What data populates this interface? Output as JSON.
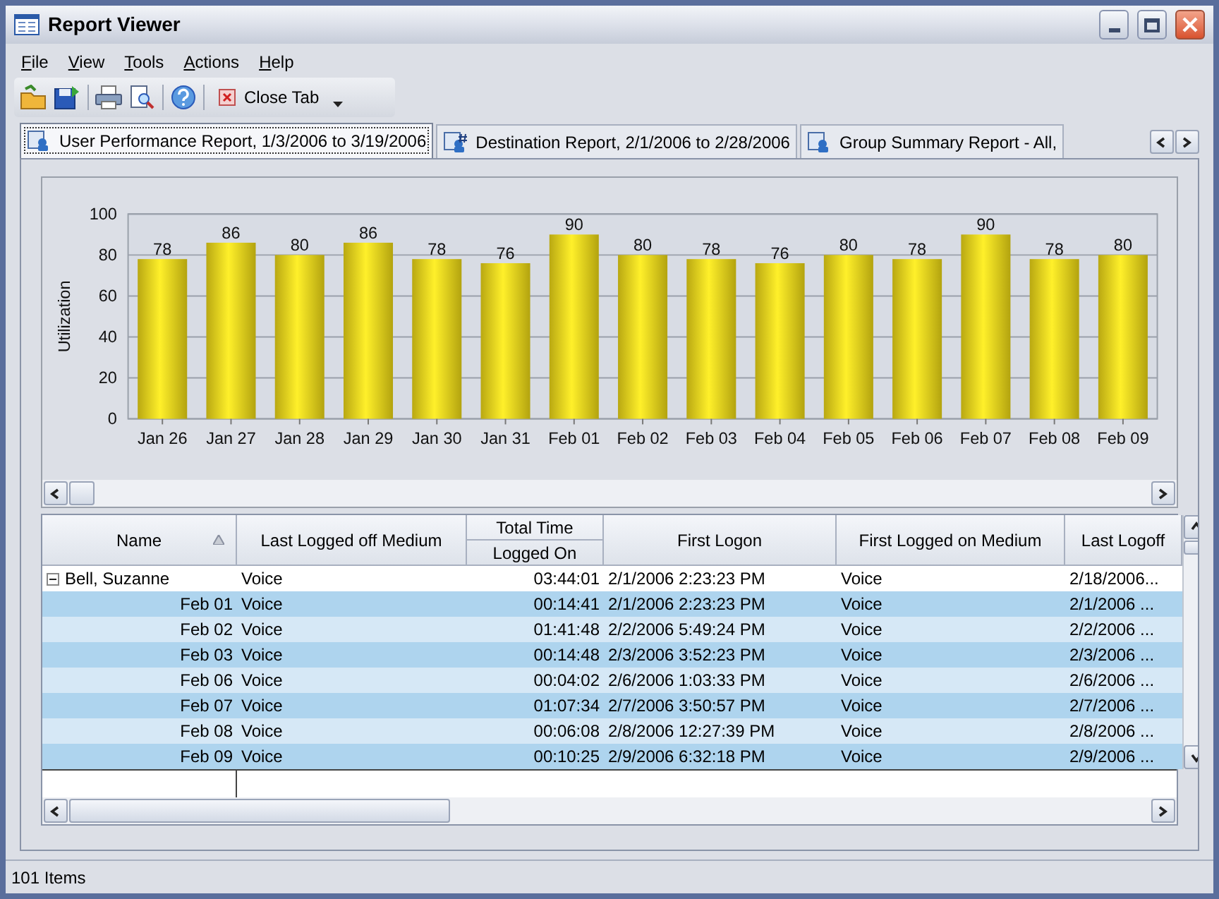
{
  "window": {
    "title": "Report Viewer"
  },
  "menu": [
    {
      "label": "File"
    },
    {
      "label": "View"
    },
    {
      "label": "Tools"
    },
    {
      "label": "Actions"
    },
    {
      "label": "Help"
    }
  ],
  "toolbar": {
    "close_tab": "Close Tab"
  },
  "tabs": [
    {
      "label": "User Performance Report, 1/3/2006 to 3/19/2006",
      "selected": true
    },
    {
      "label": "Destination Report, 2/1/2006 to 2/28/2006",
      "selected": false
    },
    {
      "label": "Group Summary Report - All,",
      "selected": false
    }
  ],
  "chart": {
    "chart_data": {
      "type": "bar",
      "ylabel": "Utilization",
      "categories": [
        "Jan 26",
        "Jan 27",
        "Jan 28",
        "Jan 29",
        "Jan 30",
        "Jan 31",
        "Feb 01",
        "Feb 02",
        "Feb 03",
        "Feb 04",
        "Feb 05",
        "Feb 06",
        "Feb 07",
        "Feb 08",
        "Feb 09"
      ],
      "values": [
        78,
        86,
        80,
        86,
        78,
        76,
        90,
        80,
        78,
        76,
        80,
        78,
        90,
        78,
        80
      ],
      "ylim": [
        0,
        100
      ],
      "yticks": [
        0,
        20,
        40,
        60,
        80,
        100
      ],
      "data_labels": true,
      "grid": true
    }
  },
  "table": {
    "columns": [
      {
        "label": "Name",
        "sorted": true
      },
      {
        "label": "Last Logged off Medium",
        "sorted": false
      },
      {
        "label": "Total Time",
        "sub_label": "Logged On",
        "sorted": false
      },
      {
        "label": "First Logon",
        "sorted": false
      },
      {
        "label": "First Logged on Medium",
        "sorted": false
      },
      {
        "label": "Last Logoff",
        "sorted": false
      }
    ],
    "rows": [
      {
        "kind": "group",
        "expanded": true,
        "cells": [
          "Bell, Suzanne",
          "Voice",
          "03:44:01",
          "2/1/2006 2:23:23 PM",
          "Voice",
          "2/18/2006..."
        ]
      },
      {
        "kind": "detail",
        "cells": [
          "Feb 01",
          "Voice",
          "00:14:41",
          "2/1/2006 2:23:23 PM",
          "Voice",
          "2/1/2006 ..."
        ]
      },
      {
        "kind": "detail",
        "cells": [
          "Feb 02",
          "Voice",
          "01:41:48",
          "2/2/2006 5:49:24 PM",
          "Voice",
          "2/2/2006 ..."
        ]
      },
      {
        "kind": "detail",
        "cells": [
          "Feb 03",
          "Voice",
          "00:14:48",
          "2/3/2006 3:52:23 PM",
          "Voice",
          "2/3/2006 ..."
        ]
      },
      {
        "kind": "detail",
        "cells": [
          "Feb 06",
          "Voice",
          "00:04:02",
          "2/6/2006 1:03:33 PM",
          "Voice",
          "2/6/2006 ..."
        ]
      },
      {
        "kind": "detail",
        "cells": [
          "Feb 07",
          "Voice",
          "01:07:34",
          "2/7/2006 3:50:57 PM",
          "Voice",
          "2/7/2006 ..."
        ]
      },
      {
        "kind": "detail",
        "cells": [
          "Feb 08",
          "Voice",
          "00:06:08",
          "2/8/2006 12:27:39 PM",
          "Voice",
          "2/8/2006 ..."
        ]
      },
      {
        "kind": "detail",
        "cells": [
          "Feb 09",
          "Voice",
          "00:10:25",
          "2/9/2006 6:32:18 PM",
          "Voice",
          "2/9/2006 ..."
        ]
      }
    ]
  },
  "status_bar": {
    "text": "101 Items"
  }
}
